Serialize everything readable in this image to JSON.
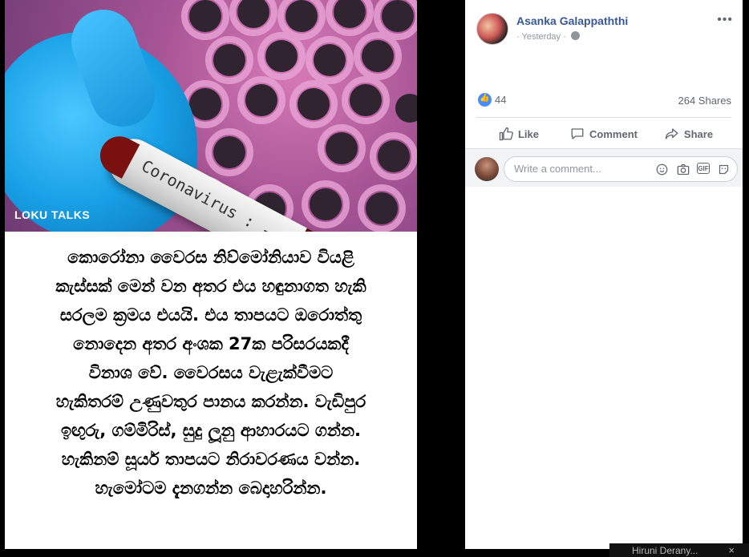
{
  "photo": {
    "vial_label": "Coronavirus :",
    "watermark": "LOKU TALKS",
    "caption_lines": [
      "කොරෝනා වෛරස නිව්මෝනියාව වියළි",
      "කැස්සක් මෙන් වන අතර එය හඳුනාගත හැකි",
      "සරලම ක්‍රමය එයයි. එය තාපයට ඔරොත්තු",
      "නොදෙන අතර අංශක 27ක පරිසරයකදී",
      "විනාශ වේ. වෛරසය වැළැක්වීමට",
      "හැකිතරම් උණුවතුර පානය කරන්න. වැඩිපුර",
      "ඉඟුරු, ගම්මිරිස්, සුදු ලූනු ආහාරයට ගන්න.",
      "හැකිනම් සූර්ය තාපයට නිරාවරණය වන්න.",
      "හැමෝටම දැනගන්න බෙදාහරින්න."
    ]
  },
  "post": {
    "author": "Asanka Galappaththi",
    "time": "Yesterday",
    "more_label": "•••",
    "reaction_count": "44",
    "shares_text": "264 Shares",
    "actions": {
      "like": "Like",
      "comment": "Comment",
      "share": "Share"
    },
    "comment_placeholder": "Write a comment...",
    "gif_label": "GIF"
  },
  "chat": {
    "name": "Hiruni Derany...",
    "close": "×"
  },
  "colors": {
    "link": "#385898",
    "like_blue": "#4a8cf7",
    "muted": "#606770"
  }
}
